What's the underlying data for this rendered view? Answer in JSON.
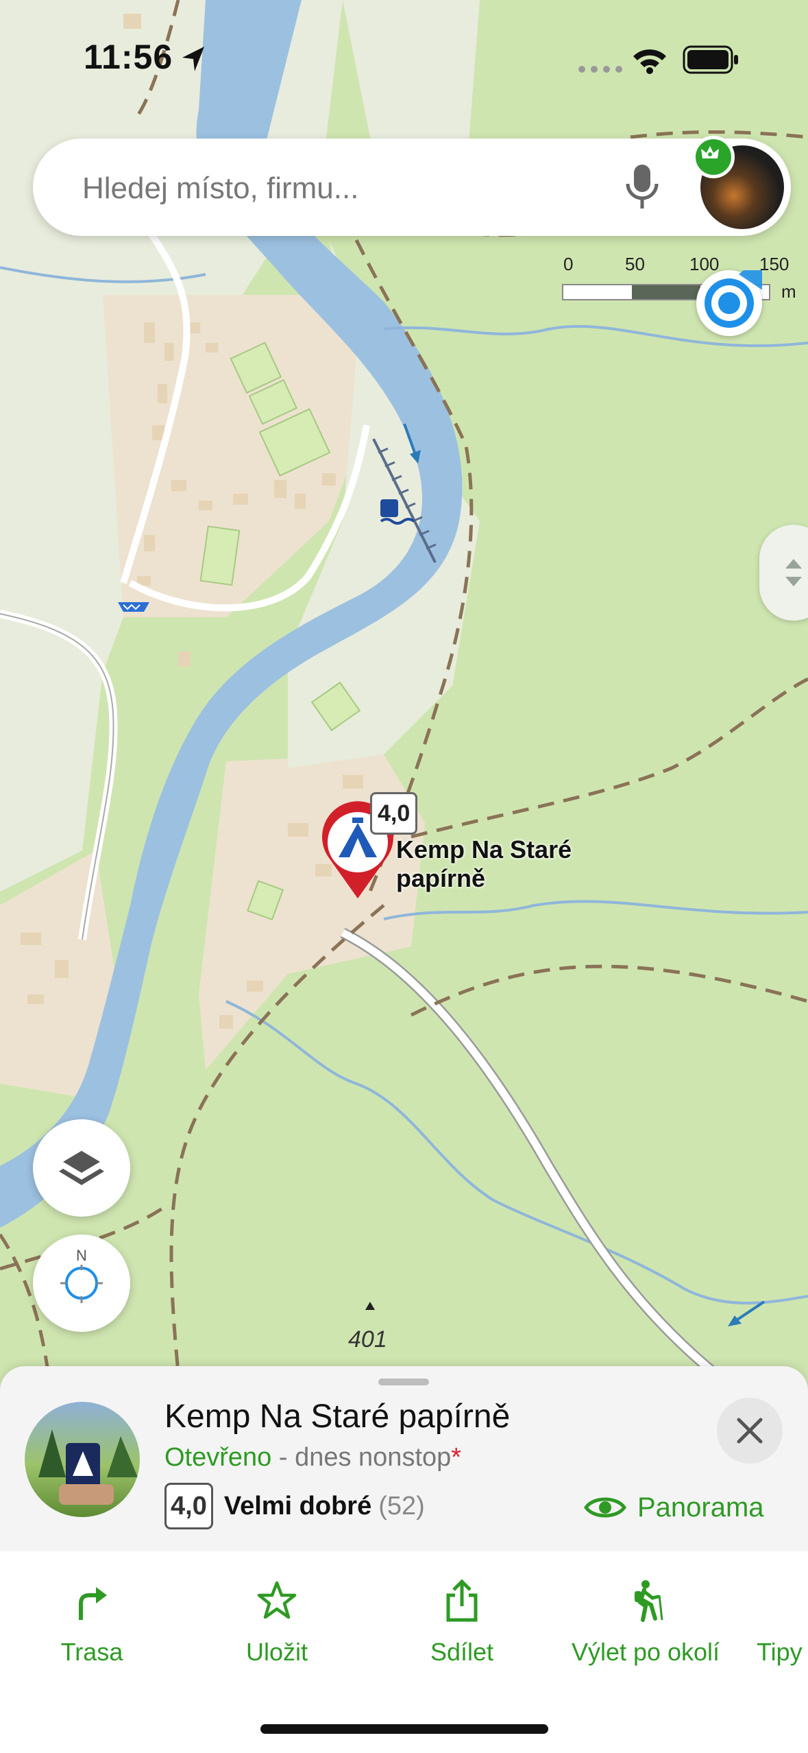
{
  "status_bar": {
    "time": "11:56"
  },
  "search": {
    "placeholder": "Hledej místo, firmu..."
  },
  "scale": {
    "labels": [
      "0",
      "50",
      "100",
      "150"
    ],
    "unit": "m"
  },
  "map": {
    "poi_name_line1": "Kemp Na Staré",
    "poi_name_line2": "papírně",
    "poi_rating": "4,0",
    "compass_label": "N",
    "elevation": "401"
  },
  "place": {
    "title": "Kemp Na Staré papírně",
    "status_open": "Otevřeno",
    "status_hours": " - dnes nonstop",
    "status_mark": "*",
    "rating": "4,0",
    "rating_word": "Velmi dobré",
    "rating_count": "(52)",
    "panorama_label": "Panorama"
  },
  "actions": [
    {
      "label": "Trasa",
      "icon": "route-icon"
    },
    {
      "label": "Uložit",
      "icon": "star-icon"
    },
    {
      "label": "Sdílet",
      "icon": "share-icon"
    },
    {
      "label": "Výlet po okolí",
      "icon": "hiker-icon"
    },
    {
      "label": "Tipy",
      "icon": "tips-icon"
    }
  ],
  "colors": {
    "accent_green": "#2e9a24",
    "water": "#9cc0e0",
    "forest": "#cfe5b0",
    "settlement": "#eee4d3",
    "pin_red": "#d2202a"
  }
}
